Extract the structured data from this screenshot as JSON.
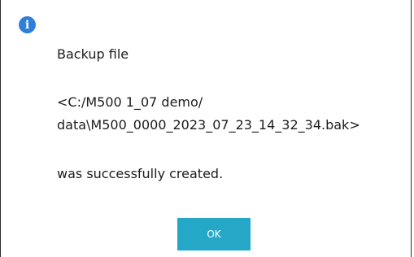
{
  "dialog": {
    "icon": "info-icon",
    "icon_glyph": "i",
    "message_line_1": "Backup file",
    "path_line_1": "<C:/M500 1_07 demo/",
    "path_line_2": "data\\M500_0000_2023_07_23_14_32_34.bak>",
    "message_line_2": "was successfully created.",
    "ok_label": "OK"
  },
  "colors": {
    "accent": "#25a8c8",
    "info": "#2f7fd8",
    "text": "#1c1c1c",
    "background": "#ffffff"
  }
}
